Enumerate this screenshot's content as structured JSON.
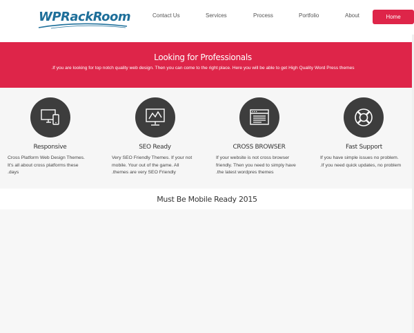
{
  "logo": {
    "text": "WPRackRoom",
    "icon": "swoosh-logo",
    "color": "#1e6f9a"
  },
  "nav": {
    "items": [
      {
        "label": "Contact Us"
      },
      {
        "label": "Services"
      },
      {
        "label": "Process"
      },
      {
        "label": "Portfolio"
      },
      {
        "label": "About"
      }
    ],
    "home_label": "Home"
  },
  "hero": {
    "title": "Looking for Professionals",
    "text": ".If you are looking for top notch quality web design. Then you can come to the right place. Here you will be able to get High Quality Word Press themes",
    "color": "#de2549"
  },
  "features": [
    {
      "icon": "devices-icon",
      "title": "Responsive",
      "lines": [
        "Cross Platform Web Design Themes.",
        "It's all about cross platforms these",
        ".days"
      ]
    },
    {
      "icon": "chart-monitor-icon",
      "title": "SEO Ready",
      "lines": [
        "Very SEO Friendly Themes. If your not",
        "mobile. Your out of the game. All",
        ".themes are very SEO Friendly"
      ]
    },
    {
      "icon": "browser-window-icon",
      "title": "CROSS BROWSER",
      "lines": [
        "If your website is not cross browser",
        "friendly. Then you need to simply have",
        ".the latest wordpres themes"
      ]
    },
    {
      "icon": "lifebuoy-icon",
      "title": "Fast Support",
      "lines": [
        "If you have simple issues no problem.",
        ".If you need quick updates, no problem"
      ]
    }
  ],
  "section": {
    "title": "Must Be Mobile Ready 2015"
  }
}
